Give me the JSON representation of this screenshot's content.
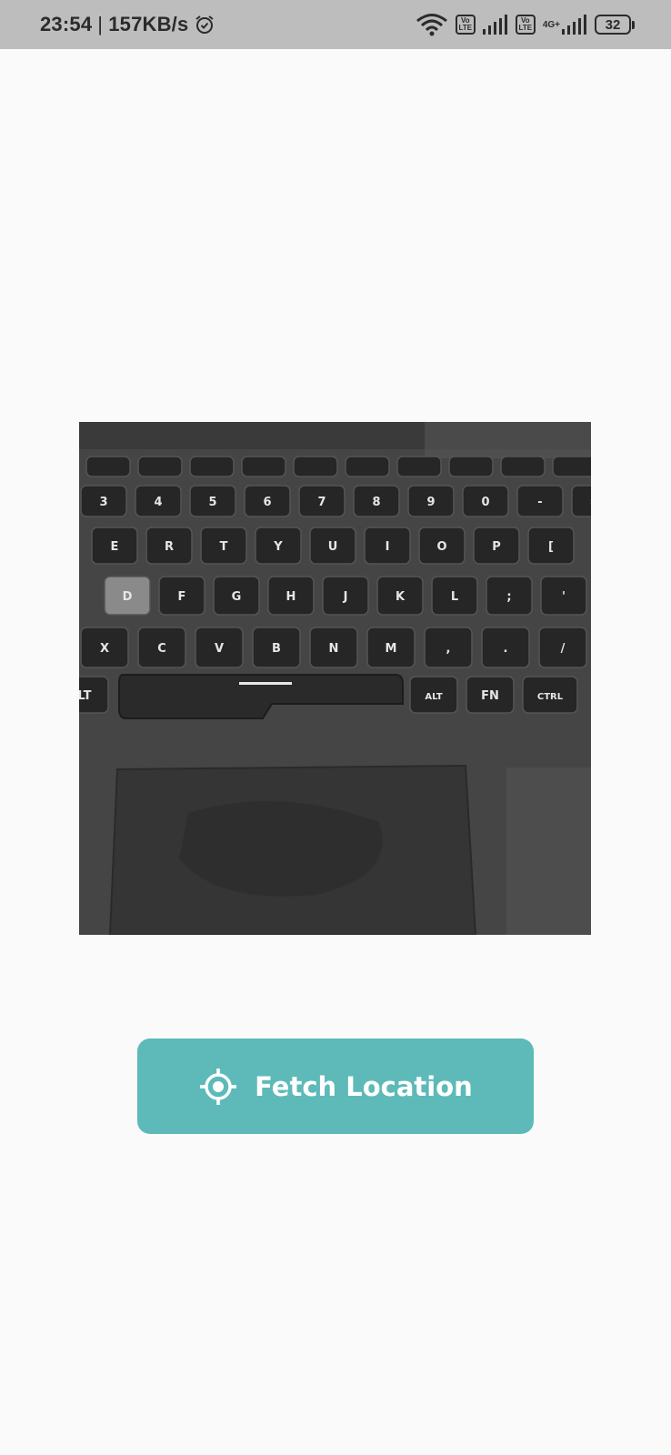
{
  "status_bar": {
    "time": "23:54",
    "separator": "|",
    "speed": "157KB/s",
    "net_type": "4G+",
    "sim1_volte_top": "Vo",
    "sim1_volte_bottom": "LTE",
    "sim2_volte_top": "Vo",
    "sim2_volte_bottom": "LTE",
    "battery": "32"
  },
  "image": {
    "row_numbers": [
      "3",
      "4",
      "5",
      "6",
      "7",
      "8",
      "9",
      "0",
      "-",
      "="
    ],
    "row_top": [
      "E",
      "R",
      "T",
      "Y",
      "U",
      "I",
      "O",
      "P",
      "["
    ],
    "row_home": [
      "D",
      "F",
      "G",
      "H",
      "J",
      "K",
      "L",
      ";",
      "'"
    ],
    "row_bottom": [
      "X",
      "C",
      "V",
      "B",
      "N",
      "M",
      ",",
      ".",
      "/"
    ],
    "row_mod": [
      "LT",
      "ALT",
      "FN",
      "CTRL"
    ]
  },
  "actions": {
    "fetch_label": "Fetch Location",
    "fetch_icon": "crosshair-gps-icon"
  },
  "colors": {
    "status_bar_bg": "#bdbdbd",
    "page_bg": "#fafafa",
    "button_bg": "#5dbab8",
    "button_text": "#ffffff"
  }
}
